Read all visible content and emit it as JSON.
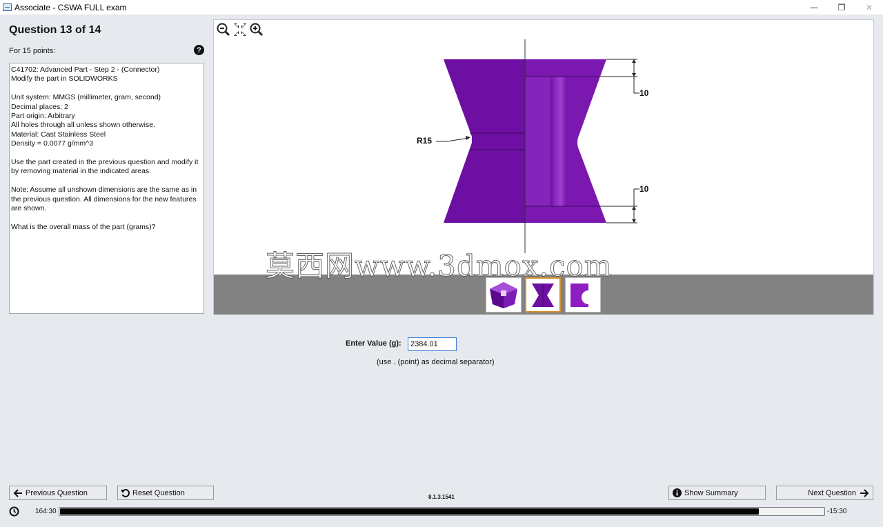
{
  "window": {
    "title": "Associate - CSWA FULL exam",
    "minimize_glyph": "—",
    "restore_glyph": "❐",
    "close_glyph": "✕"
  },
  "question": {
    "title": "Question 13 of 14",
    "points": "For 15 points:",
    "help_glyph": "?",
    "lines": [
      "C41702:  Advanced Part - Step 2 - (Connector)",
      "Modify the part in SOLIDWORKS",
      "",
      "Unit system: MMGS (millimeter, gram, second)",
      "Decimal places: 2",
      "Part origin: Arbitrary",
      "All holes through all unless shown otherwise.",
      "Material: Cast Stainless Steel",
      "Density = 0.0077 g/mm^3",
      "",
      "Use the part created in the previous question and modify it by removing material in the indicated areas.",
      "",
      "Note: Assume all unshown dimensions are the same as in the previous question.  All dimensions for the new features are shown.",
      "",
      "What is the overall mass of the part (grams)?"
    ]
  },
  "viewer": {
    "tools": [
      "zoom-out-icon",
      "fit-to-view-icon",
      "zoom-in-icon"
    ],
    "dimensions": {
      "top": "10",
      "bottom": "10",
      "radius": "R15"
    },
    "part_color": "#7a13a8",
    "thumbnails": [
      {
        "name": "isometric-view",
        "selected": false
      },
      {
        "name": "front-view",
        "selected": true
      },
      {
        "name": "top-view",
        "selected": false
      }
    ],
    "watermark": "莫西网www.3dmox.com"
  },
  "answer": {
    "label": "Enter Value (g):",
    "value": "2384.01",
    "hint": "(use . (point) as decimal separator)"
  },
  "footer": {
    "previous_label": "Previous Question",
    "reset_label": "Reset Question",
    "version": "8.1.3.1541",
    "summary_label": "Show Summary",
    "next_label": "Next Question",
    "elapsed": "164:30",
    "remaining": "-15:30",
    "progress_fraction": 0.915
  }
}
